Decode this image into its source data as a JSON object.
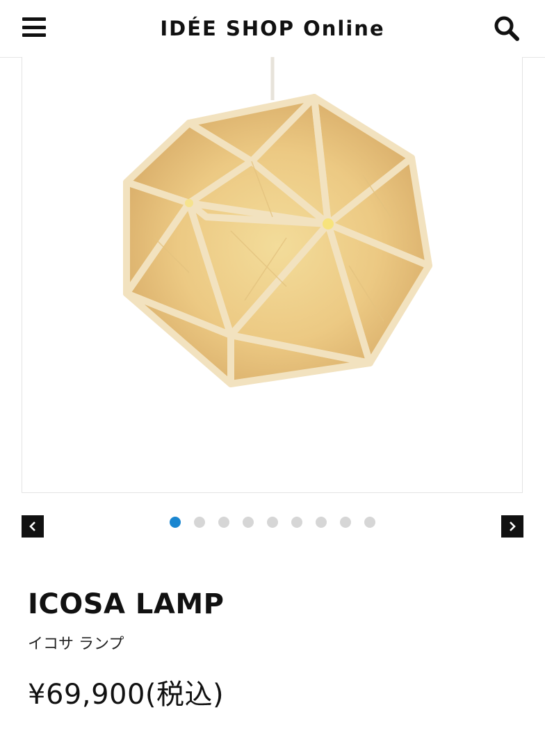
{
  "header": {
    "title": "IDÉE SHOP Online",
    "menu_icon": "hamburger-menu-icon",
    "search_icon": "search-icon"
  },
  "gallery": {
    "image_subject": "ICOSA LAMP",
    "image_count": 9,
    "active_index": 0,
    "prev_icon": "chevron-left-icon",
    "next_icon": "chevron-right-icon",
    "active_dot_color": "#1a86d0",
    "inactive_dot_color": "#d6d6d6"
  },
  "product": {
    "name": "ICOSA LAMP",
    "name_ja": "イコサ ランプ",
    "price": "¥69,900(税込)"
  }
}
